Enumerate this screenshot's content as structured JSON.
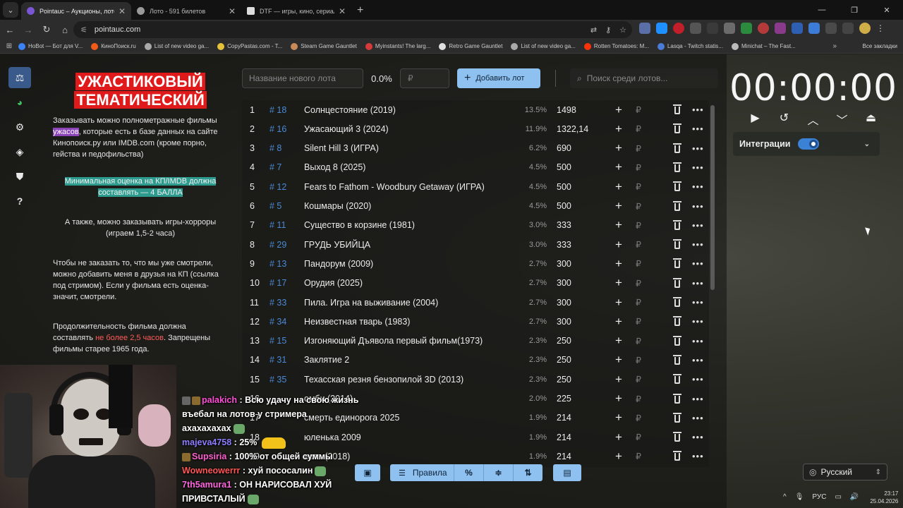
{
  "browser": {
    "tabs": [
      {
        "title": "Pointauc – Аукционы, лотереи",
        "active": true,
        "fav_color": "#7a55d6"
      },
      {
        "title": "Лото - 591 билетов",
        "active": false,
        "fav_color": "#9a9a9a"
      },
      {
        "title": "DTF — игры, кино, сериалы, р",
        "active": false,
        "fav_color": "#dddddd"
      }
    ],
    "url": "pointauc.com",
    "bookmarks": [
      {
        "label": "HoBot — Бот для V...",
        "color": "#3b82f6"
      },
      {
        "label": "КиноПоиск.ru",
        "color": "#f25a1a"
      },
      {
        "label": "List of new video ga...",
        "color": "#aaaaaa"
      },
      {
        "label": "CopyPastas.com - T...",
        "color": "#e6c23a"
      },
      {
        "label": "Steam Game Gauntlet",
        "color": "#c98a5a"
      },
      {
        "label": "Myinstants! The larg...",
        "color": "#d63a3a"
      },
      {
        "label": "Retro Game Gauntlet",
        "color": "#e0e0e0"
      },
      {
        "label": "List of new video ga...",
        "color": "#aaaaaa"
      },
      {
        "label": "Rotten Tomatoes: M...",
        "color": "#fa320a"
      },
      {
        "label": "Lasqa - Twitch statis...",
        "color": "#4a7bd6"
      },
      {
        "label": "Minichat – The Fast...",
        "color": "#bbbbbb"
      }
    ],
    "all_bookmarks": "Все закладки"
  },
  "sidebar": [
    {
      "name": "auction-icon",
      "glyph": "⚖",
      "active": true
    },
    {
      "name": "wheel-icon",
      "glyph": "◕",
      "active": false
    },
    {
      "name": "settings-icon",
      "glyph": "⚙",
      "active": false
    },
    {
      "name": "layers-icon",
      "glyph": "◈",
      "active": false
    },
    {
      "name": "shield-icon",
      "glyph": "⛊",
      "active": false
    },
    {
      "name": "help-icon",
      "glyph": "?",
      "active": false
    }
  ],
  "rules": {
    "title_line1": "УЖАСТИКОВЫЙ",
    "title_line2": "ТЕМАТИЧЕСКИЙ",
    "p1_before": "Заказывать можно полнометражные фильмы ",
    "p1_highlight": "ужасов",
    "p1_after": ", которые есть в базе данных на сайте Кинопоиск.ру или IMDB.com (кроме порно, гейства и педофильства)",
    "p2": "Минимальная оценка на КП/IMDB должна составлять — 4 БАЛЛА",
    "p3": "А также, можно заказывать игры-хорроры (играем 1,5-2 часа)",
    "p4": "Чтобы не заказать то, что мы уже смотрели, можно добавить меня в друзья на КП (ссылка под стримом). Если у фильма есть оценка- значит, смотрели.",
    "p5_before": "Продолжительность фильма должна составлять ",
    "p5_red": "не более 2,5 часов",
    "p5_after": ". Запрещены фильмы старее 1965 года."
  },
  "controls": {
    "lot_placeholder": "Название нового лота",
    "percent": "0.0%",
    "currency": "₽",
    "add_label": "Добавить лот",
    "search_placeholder": "Поиск среди лотов..."
  },
  "lots": [
    {
      "n": "1",
      "id": "# 18",
      "name": "Солнцестояние (2019)",
      "pct": "13.5%",
      "amount": "1498"
    },
    {
      "n": "2",
      "id": "# 16",
      "name": "Ужасающий 3 (2024)",
      "pct": "11.9%",
      "amount": "1322,14"
    },
    {
      "n": "3",
      "id": "# 8",
      "name": "Silent Hill 3 (ИГРА)",
      "pct": "6.2%",
      "amount": "690"
    },
    {
      "n": "4",
      "id": "# 7",
      "name": "Выход 8 (2025)",
      "pct": "4.5%",
      "amount": "500"
    },
    {
      "n": "5",
      "id": "# 12",
      "name": "Fears to Fathom - Woodbury Getaway (ИГРА)",
      "pct": "4.5%",
      "amount": "500"
    },
    {
      "n": "6",
      "id": "# 5",
      "name": "Кошмары (2020)",
      "pct": "4.5%",
      "amount": "500"
    },
    {
      "n": "7",
      "id": "# 11",
      "name": "Существо в корзине (1981)",
      "pct": "3.0%",
      "amount": "333"
    },
    {
      "n": "8",
      "id": "# 29",
      "name": "ГРУДЬ УБИЙЦА",
      "pct": "3.0%",
      "amount": "333"
    },
    {
      "n": "9",
      "id": "# 13",
      "name": "Пандорум (2009)",
      "pct": "2.7%",
      "amount": "300"
    },
    {
      "n": "10",
      "id": "# 17",
      "name": "Орудия (2025)",
      "pct": "2.7%",
      "amount": "300"
    },
    {
      "n": "11",
      "id": "# 33",
      "name": "Пила. Игра на выживание (2004)",
      "pct": "2.7%",
      "amount": "300"
    },
    {
      "n": "12",
      "id": "# 34",
      "name": "Неизвестная тварь (1983)",
      "pct": "2.7%",
      "amount": "300"
    },
    {
      "n": "13",
      "id": "# 15",
      "name": "Изгоняющий Дъявола первый фильм(1973)",
      "pct": "2.3%",
      "amount": "250"
    },
    {
      "n": "14",
      "id": "# 31",
      "name": "Заклятие 2",
      "pct": "2.3%",
      "amount": "250"
    },
    {
      "n": "15",
      "id": "# 35",
      "name": "Техасская резня бензопилой 3D (2013)",
      "pct": "2.3%",
      "amount": "250"
    },
    {
      "n": "16",
      "id": "",
      "name": "омби (2014)",
      "pct": "2.0%",
      "amount": "225"
    },
    {
      "n": "17",
      "id": "",
      "name": "смерть единорога 2025",
      "pct": "1.9%",
      "amount": "214"
    },
    {
      "n": "18",
      "id": "",
      "name": "юленька 2009",
      "pct": "1.9%",
      "amount": "214"
    },
    {
      "n": "19",
      "id": "",
      "name": "еста (2018)",
      "pct": "1.9%",
      "amount": "214"
    }
  ],
  "lot_actions": {
    "plus": "+",
    "rub": "₽",
    "more": "•••"
  },
  "timer": {
    "value": "00:00:00"
  },
  "integrations": {
    "label": "Интеграции",
    "enabled": true
  },
  "language": "Русский",
  "bottom_bar": {
    "rules_label": "Правила",
    "percent_glyph": "%"
  },
  "chat": [
    {
      "user": "palakich",
      "text": "Всю удачу на свою жизнь въебал на лотов у стримера"
    },
    {
      "user": "",
      "text": "ахахахахах"
    },
    {
      "user": "majeva4758",
      "text": "25%"
    },
    {
      "user": "Supsiria",
      "text": "100% от общей суммы"
    },
    {
      "user": "Wowneowerrr",
      "text": "хуй пососалин"
    },
    {
      "user": "7th5amura1",
      "text": "ОН НАРИСОВАЛ ХУЙ ПРИВСТАЛЫЙ"
    }
  ],
  "tray": {
    "lang": "РУС",
    "time": "23:17",
    "date": "25.04.2026"
  }
}
